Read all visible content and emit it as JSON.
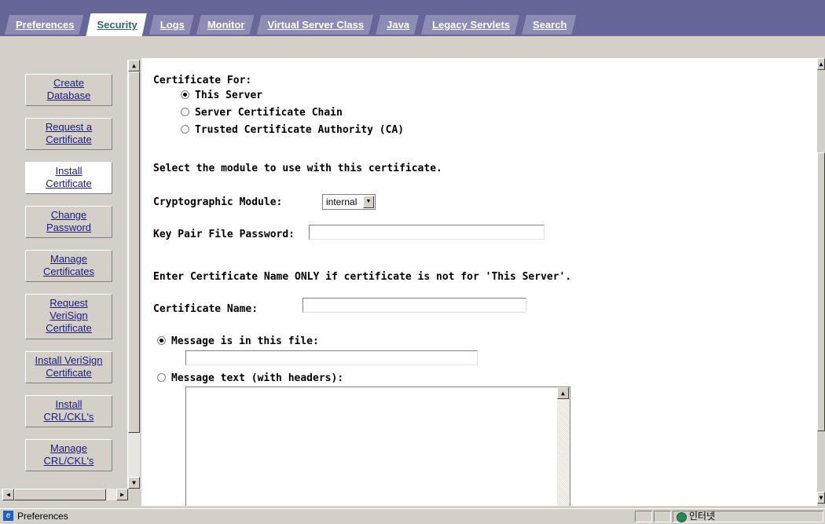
{
  "tabs": [
    {
      "label": "Preferences",
      "active": false
    },
    {
      "label": "Security",
      "active": true
    },
    {
      "label": "Logs",
      "active": false
    },
    {
      "label": "Monitor",
      "active": false
    },
    {
      "label": "Virtual Server Class",
      "active": false
    },
    {
      "label": "Java",
      "active": false
    },
    {
      "label": "Legacy Servlets",
      "active": false
    },
    {
      "label": "Search",
      "active": false
    }
  ],
  "sidebar": {
    "items": [
      {
        "line1": "Create",
        "line2": "Database",
        "line3": ""
      },
      {
        "line1": "Request a",
        "line2": "Certificate",
        "line3": ""
      },
      {
        "line1": "Install",
        "line2": "Certificate",
        "line3": ""
      },
      {
        "line1": "Change",
        "line2": "Password",
        "line3": ""
      },
      {
        "line1": "Manage",
        "line2": "Certificates",
        "line3": ""
      },
      {
        "line1": "Request",
        "line2": "VeriSign",
        "line3": "Certificate"
      },
      {
        "line1": "Install VeriSign",
        "line2": "Certificate",
        "line3": ""
      },
      {
        "line1": "Install",
        "line2": "CRL/CKL's",
        "line3": ""
      },
      {
        "line1": "Manage",
        "line2": "CRL/CKL's",
        "line3": ""
      }
    ],
    "selected": "Install Certificate"
  },
  "form": {
    "cert_for_label": "Certificate For:",
    "cert_for_options": [
      "This Server",
      "Server Certificate Chain",
      "Trusted Certificate Authority (CA)"
    ],
    "cert_for_selected": "This Server",
    "module_instruction": "Select the module to use with this certificate.",
    "crypto_module_label": "Cryptographic Module:",
    "crypto_module_value": "internal",
    "key_pair_label": "Key Pair File Password:",
    "key_pair_value": "",
    "cert_name_instruction": "Enter Certificate Name ONLY if certificate is not for 'This Server'.",
    "cert_name_label": "Certificate Name:",
    "cert_name_value": "",
    "message_file_label": "Message is in this file:",
    "message_file_value": "",
    "message_text_label": "Message text (with headers):",
    "message_text_value": "",
    "message_source_selected": "file"
  },
  "status_bar": {
    "text": "Preferences",
    "zone": "인터넷"
  }
}
